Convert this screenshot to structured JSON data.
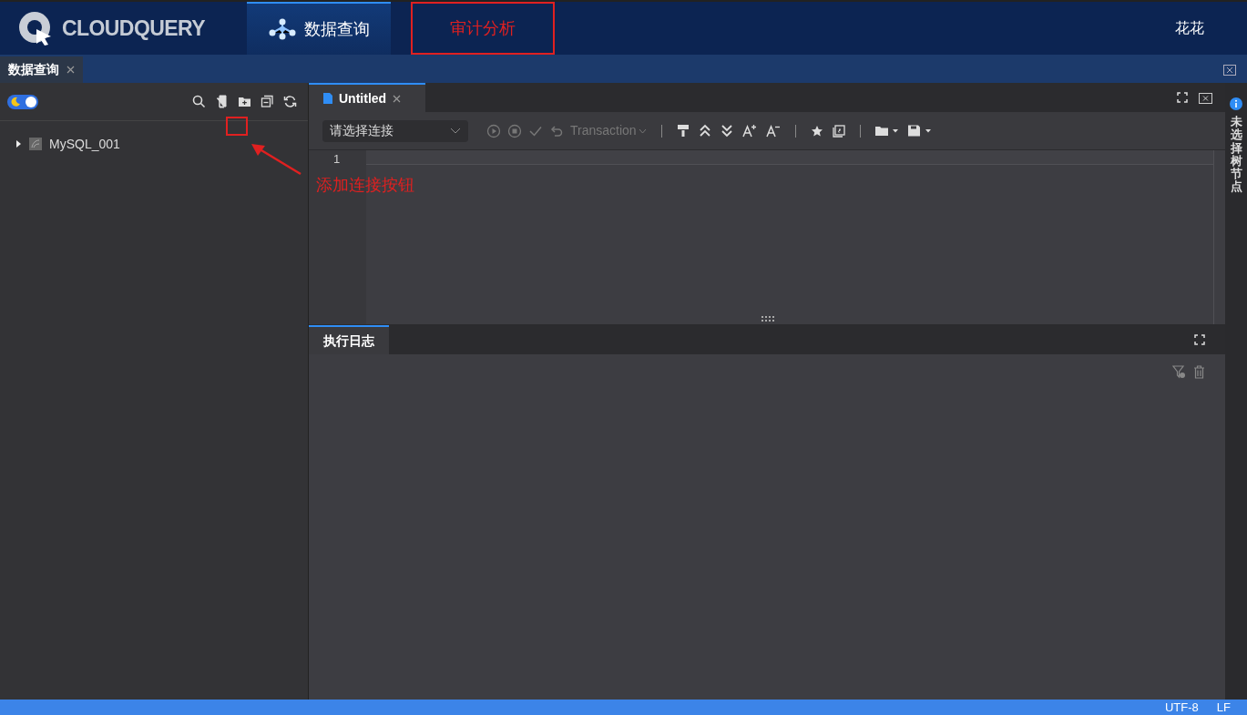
{
  "header": {
    "logo_text": "CLOUDQUERY",
    "nav": [
      {
        "label": "数据查询",
        "selected": true,
        "highlighted": false
      },
      {
        "label": "审计分析",
        "selected": false,
        "highlighted": true
      }
    ],
    "user": "花花"
  },
  "page_tabs": [
    {
      "label": "数据查询",
      "selected": true
    }
  ],
  "sidebar": {
    "theme_toggle": {
      "on": true
    },
    "tree": [
      {
        "label": "MySQL_001",
        "expanded": false
      }
    ]
  },
  "annotation": {
    "label": "添加连接按钮"
  },
  "editor": {
    "tabs": [
      {
        "label": "Untitled",
        "selected": true
      }
    ],
    "connection_placeholder": "请选择连接",
    "transaction_label": "Transaction",
    "line_numbers": [
      "1"
    ]
  },
  "log": {
    "tabs": [
      {
        "label": "执行日志",
        "selected": true
      }
    ]
  },
  "side_panel": {
    "label": "未选择树节点"
  },
  "status_bar": [
    "UTF-8",
    "LF"
  ]
}
